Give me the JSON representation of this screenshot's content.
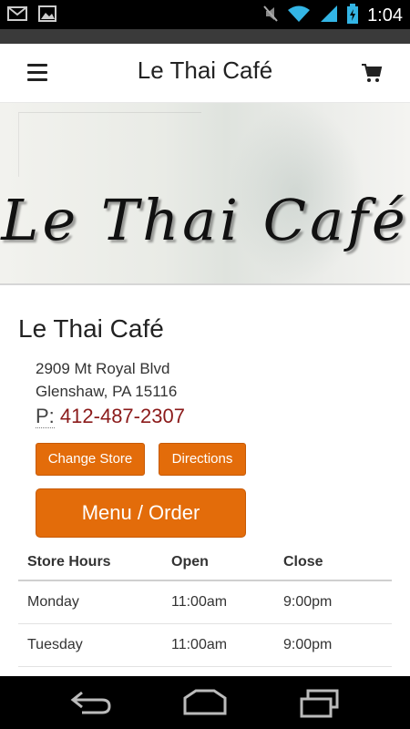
{
  "status_bar": {
    "time": "1:04",
    "icons": [
      "gmail-icon",
      "image-icon",
      "mute-icon",
      "wifi-icon",
      "signal-icon",
      "battery-icon"
    ]
  },
  "header": {
    "title": "Le Thai Café"
  },
  "banner": {
    "logo_text": "Le Thai Café"
  },
  "store": {
    "name": "Le Thai Café",
    "address_line1": "2909 Mt Royal Blvd",
    "address_line2": "Glenshaw, PA 15116",
    "phone_prefix": "P:",
    "phone": "412-487-2307"
  },
  "buttons": {
    "change_store": "Change Store",
    "directions": "Directions",
    "menu_order": "Menu / Order"
  },
  "hours": {
    "headers": [
      "Store Hours",
      "Open",
      "Close"
    ],
    "rows": [
      [
        "Monday",
        "11:00am",
        "9:00pm"
      ],
      [
        "Tuesday",
        "11:00am",
        "9:00pm"
      ]
    ]
  },
  "colors": {
    "accent": "#e36c0a",
    "phone": "#8b1a1a"
  },
  "nav_bar": {
    "icons": [
      "back-icon",
      "home-icon",
      "recent-apps-icon"
    ]
  }
}
